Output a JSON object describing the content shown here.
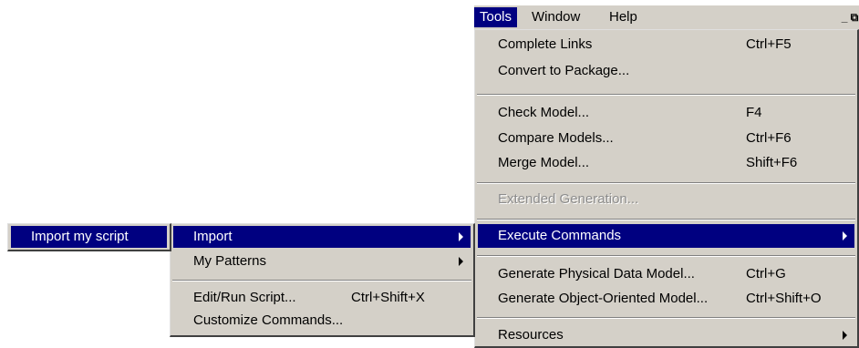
{
  "menubar": {
    "tools": "Tools",
    "window": "Window",
    "help": "Help",
    "window_controls": "_ ⧉"
  },
  "tools_menu": {
    "complete_links": {
      "label": "Complete Links",
      "shortcut": "Ctrl+F5"
    },
    "convert_to_package": {
      "label": "Convert to Package..."
    },
    "check_model": {
      "label": "Check Model...",
      "shortcut": "F4"
    },
    "compare_models": {
      "label": "Compare Models...",
      "shortcut": "Ctrl+F6"
    },
    "merge_model": {
      "label": "Merge Model...",
      "shortcut": "Shift+F6"
    },
    "extended_generation": {
      "label": "Extended Generation..."
    },
    "execute_commands": {
      "label": "Execute Commands"
    },
    "generate_pdm": {
      "label": "Generate Physical Data Model...",
      "shortcut": "Ctrl+G"
    },
    "generate_oom": {
      "label": "Generate Object-Oriented Model...",
      "shortcut": "Ctrl+Shift+O"
    },
    "resources": {
      "label": "Resources"
    }
  },
  "execute_submenu": {
    "import": {
      "label": "Import"
    },
    "my_patterns": {
      "label": "My Patterns"
    },
    "edit_run_script": {
      "label": "Edit/Run Script...",
      "shortcut": "Ctrl+Shift+X"
    },
    "customize_commands": {
      "label": "Customize Commands..."
    }
  },
  "import_submenu": {
    "import_my_script": {
      "label": "Import my script"
    }
  },
  "colors": {
    "menu_bg": "#d4d0c8",
    "highlight": "#000080",
    "disabled": "#8c8c8c"
  }
}
